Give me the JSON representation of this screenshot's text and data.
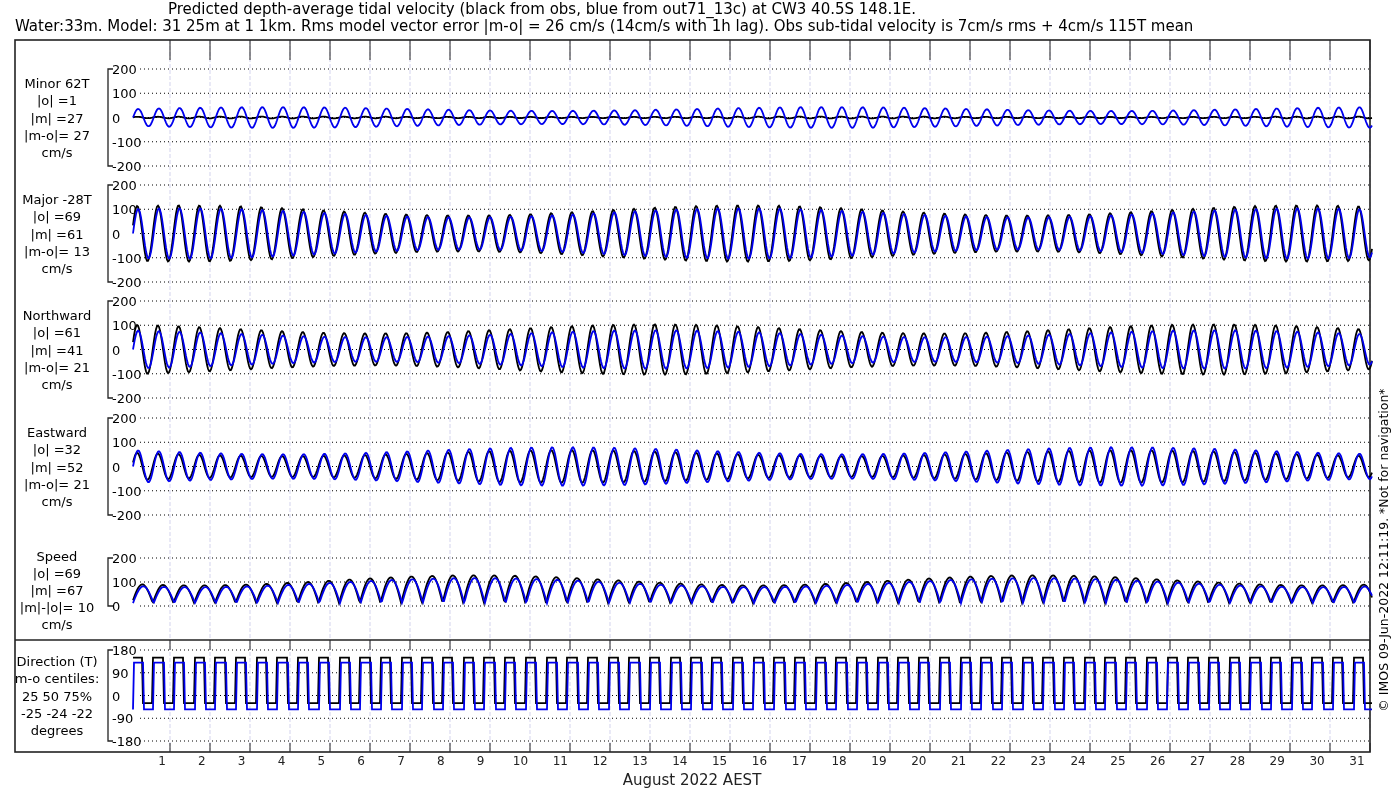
{
  "title": [
    "Predicted depth-average tidal velocity (black from obs, blue from out71_13c) at CW3 40.5S 148.1E.",
    "Water:33m. Model: 31 25m at 1 1km. Rms model vector error |m-o| = 26 cm/s (14cm/s with 1h lag). Obs sub-tidal velocity is 7cm/s rms + 4cm/s 115T mean"
  ],
  "panels": [
    {
      "kind": "velocity",
      "label_lines": [
        "Minor 62T",
        "|o| =1",
        "|m| =27",
        "|m-o|= 27",
        "cm/s"
      ],
      "yticks": [
        "200",
        "100",
        "0",
        "-100",
        "-200"
      ]
    },
    {
      "kind": "velocity",
      "label_lines": [
        "Major -28T",
        "|o| =69",
        "|m| =61",
        "|m-o|= 13",
        "cm/s"
      ],
      "yticks": [
        "200",
        "100",
        "0",
        "-100",
        "-200"
      ]
    },
    {
      "kind": "velocity",
      "label_lines": [
        "Northward",
        "|o| =61",
        "|m| =41",
        "|m-o|= 21",
        "cm/s"
      ],
      "yticks": [
        "200",
        "100",
        "0",
        "-100",
        "-200"
      ]
    },
    {
      "kind": "velocity",
      "label_lines": [
        "Eastward",
        "|o| =32",
        "|m| =52",
        "|m-o|= 21",
        "cm/s"
      ],
      "yticks": [
        "200",
        "100",
        "0",
        "-100",
        "-200"
      ]
    },
    {
      "kind": "speed",
      "label_lines": [
        "Speed",
        "|o| =69",
        "|m| =67",
        "|m|-|o|= 10",
        "cm/s"
      ],
      "yticks": [
        "200",
        "100",
        "0"
      ]
    },
    {
      "kind": "direction",
      "label_lines": [
        "Direction (T)",
        "m-o centiles:",
        "25  50  75%",
        "-25 -24 -22",
        "degrees"
      ],
      "yticks": [
        "180",
        "90",
        "0",
        "-90",
        "-180"
      ]
    }
  ],
  "xaxis": {
    "ticks": [
      "1",
      "2",
      "3",
      "4",
      "5",
      "6",
      "7",
      "8",
      "9",
      "10",
      "11",
      "12",
      "13",
      "14",
      "15",
      "16",
      "17",
      "18",
      "19",
      "20",
      "21",
      "22",
      "23",
      "24",
      "25",
      "26",
      "27",
      "28",
      "29",
      "30",
      "31"
    ],
    "label": "August 2022 AEST"
  },
  "side_note": "© IMOS 09-Jun-2022 12:11:19. *Not for navigation*"
}
